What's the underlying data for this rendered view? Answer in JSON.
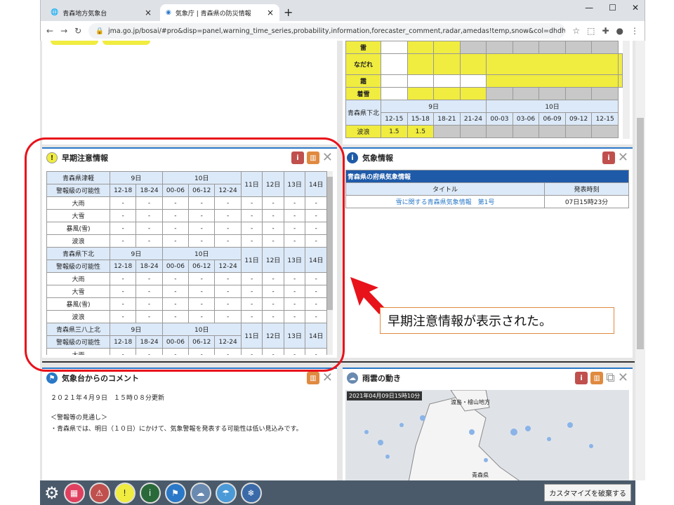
{
  "browser": {
    "tabs": [
      {
        "label": "青森地方気象台"
      },
      {
        "label": "気象庁 | 青森県の防災情報"
      }
    ],
    "url": "jma.go.jp/bosai/#pro&disp=panel,warning_time_series,probability,information,forecaster_comment,radar,amedas!temp,snow&col=dhdhdhdhdhdh..."
  },
  "top_right": {
    "rows": [
      "雷",
      "なだれ",
      "霜",
      "着雪"
    ],
    "region": "青森県下北",
    "day9": "9日",
    "day10": "10日",
    "times": [
      "12-15",
      "15-18",
      "18-21",
      "21-24",
      "00-03",
      "03-06",
      "06-09",
      "09-12",
      "12-15"
    ],
    "wave_label": "波浪",
    "wave_vals": [
      "1.5",
      "1.5"
    ]
  },
  "early": {
    "title": "早期注意情報",
    "blocks": [
      {
        "region": "青森県津軽"
      },
      {
        "region": "青森県下北"
      },
      {
        "region": "青森県三八上北"
      }
    ],
    "possibility": "警報級の可能性",
    "day9": "9日",
    "day10": "10日",
    "d11": "11日",
    "d12": "12日",
    "d13": "13日",
    "d14": "14日",
    "times": [
      "12-18",
      "18-24",
      "00-06",
      "06-12",
      "12-24"
    ],
    "rows": [
      "大雨",
      "大雪",
      "暴風(雪)",
      "波浪"
    ],
    "dash": "-"
  },
  "weather_info": {
    "title": "気象情報",
    "table_title": "青森県の府県気象情報",
    "col_title": "タイトル",
    "col_time": "発表時刻",
    "row_title": "雪に関する青森県気象情報　第1号",
    "row_time": "07日15時23分"
  },
  "comment": {
    "title": "気象台からのコメント",
    "updated": "２０２１年４月９日　１５時０８分更新",
    "heading": "＜警報等の見通し＞",
    "body": "・青森県では、明日（１０日）にかけて、気象警報を発表する可能性は低い見込みです。"
  },
  "radar": {
    "title": "雨雲の動き",
    "timestamp": "2021年04月09日15時10分",
    "place1": "渡島・檜山地方",
    "place2": "青森県"
  },
  "callout": "早期注意情報が表示された。",
  "toolbar": {
    "custom_label": "カスタマイズを破棄する"
  }
}
